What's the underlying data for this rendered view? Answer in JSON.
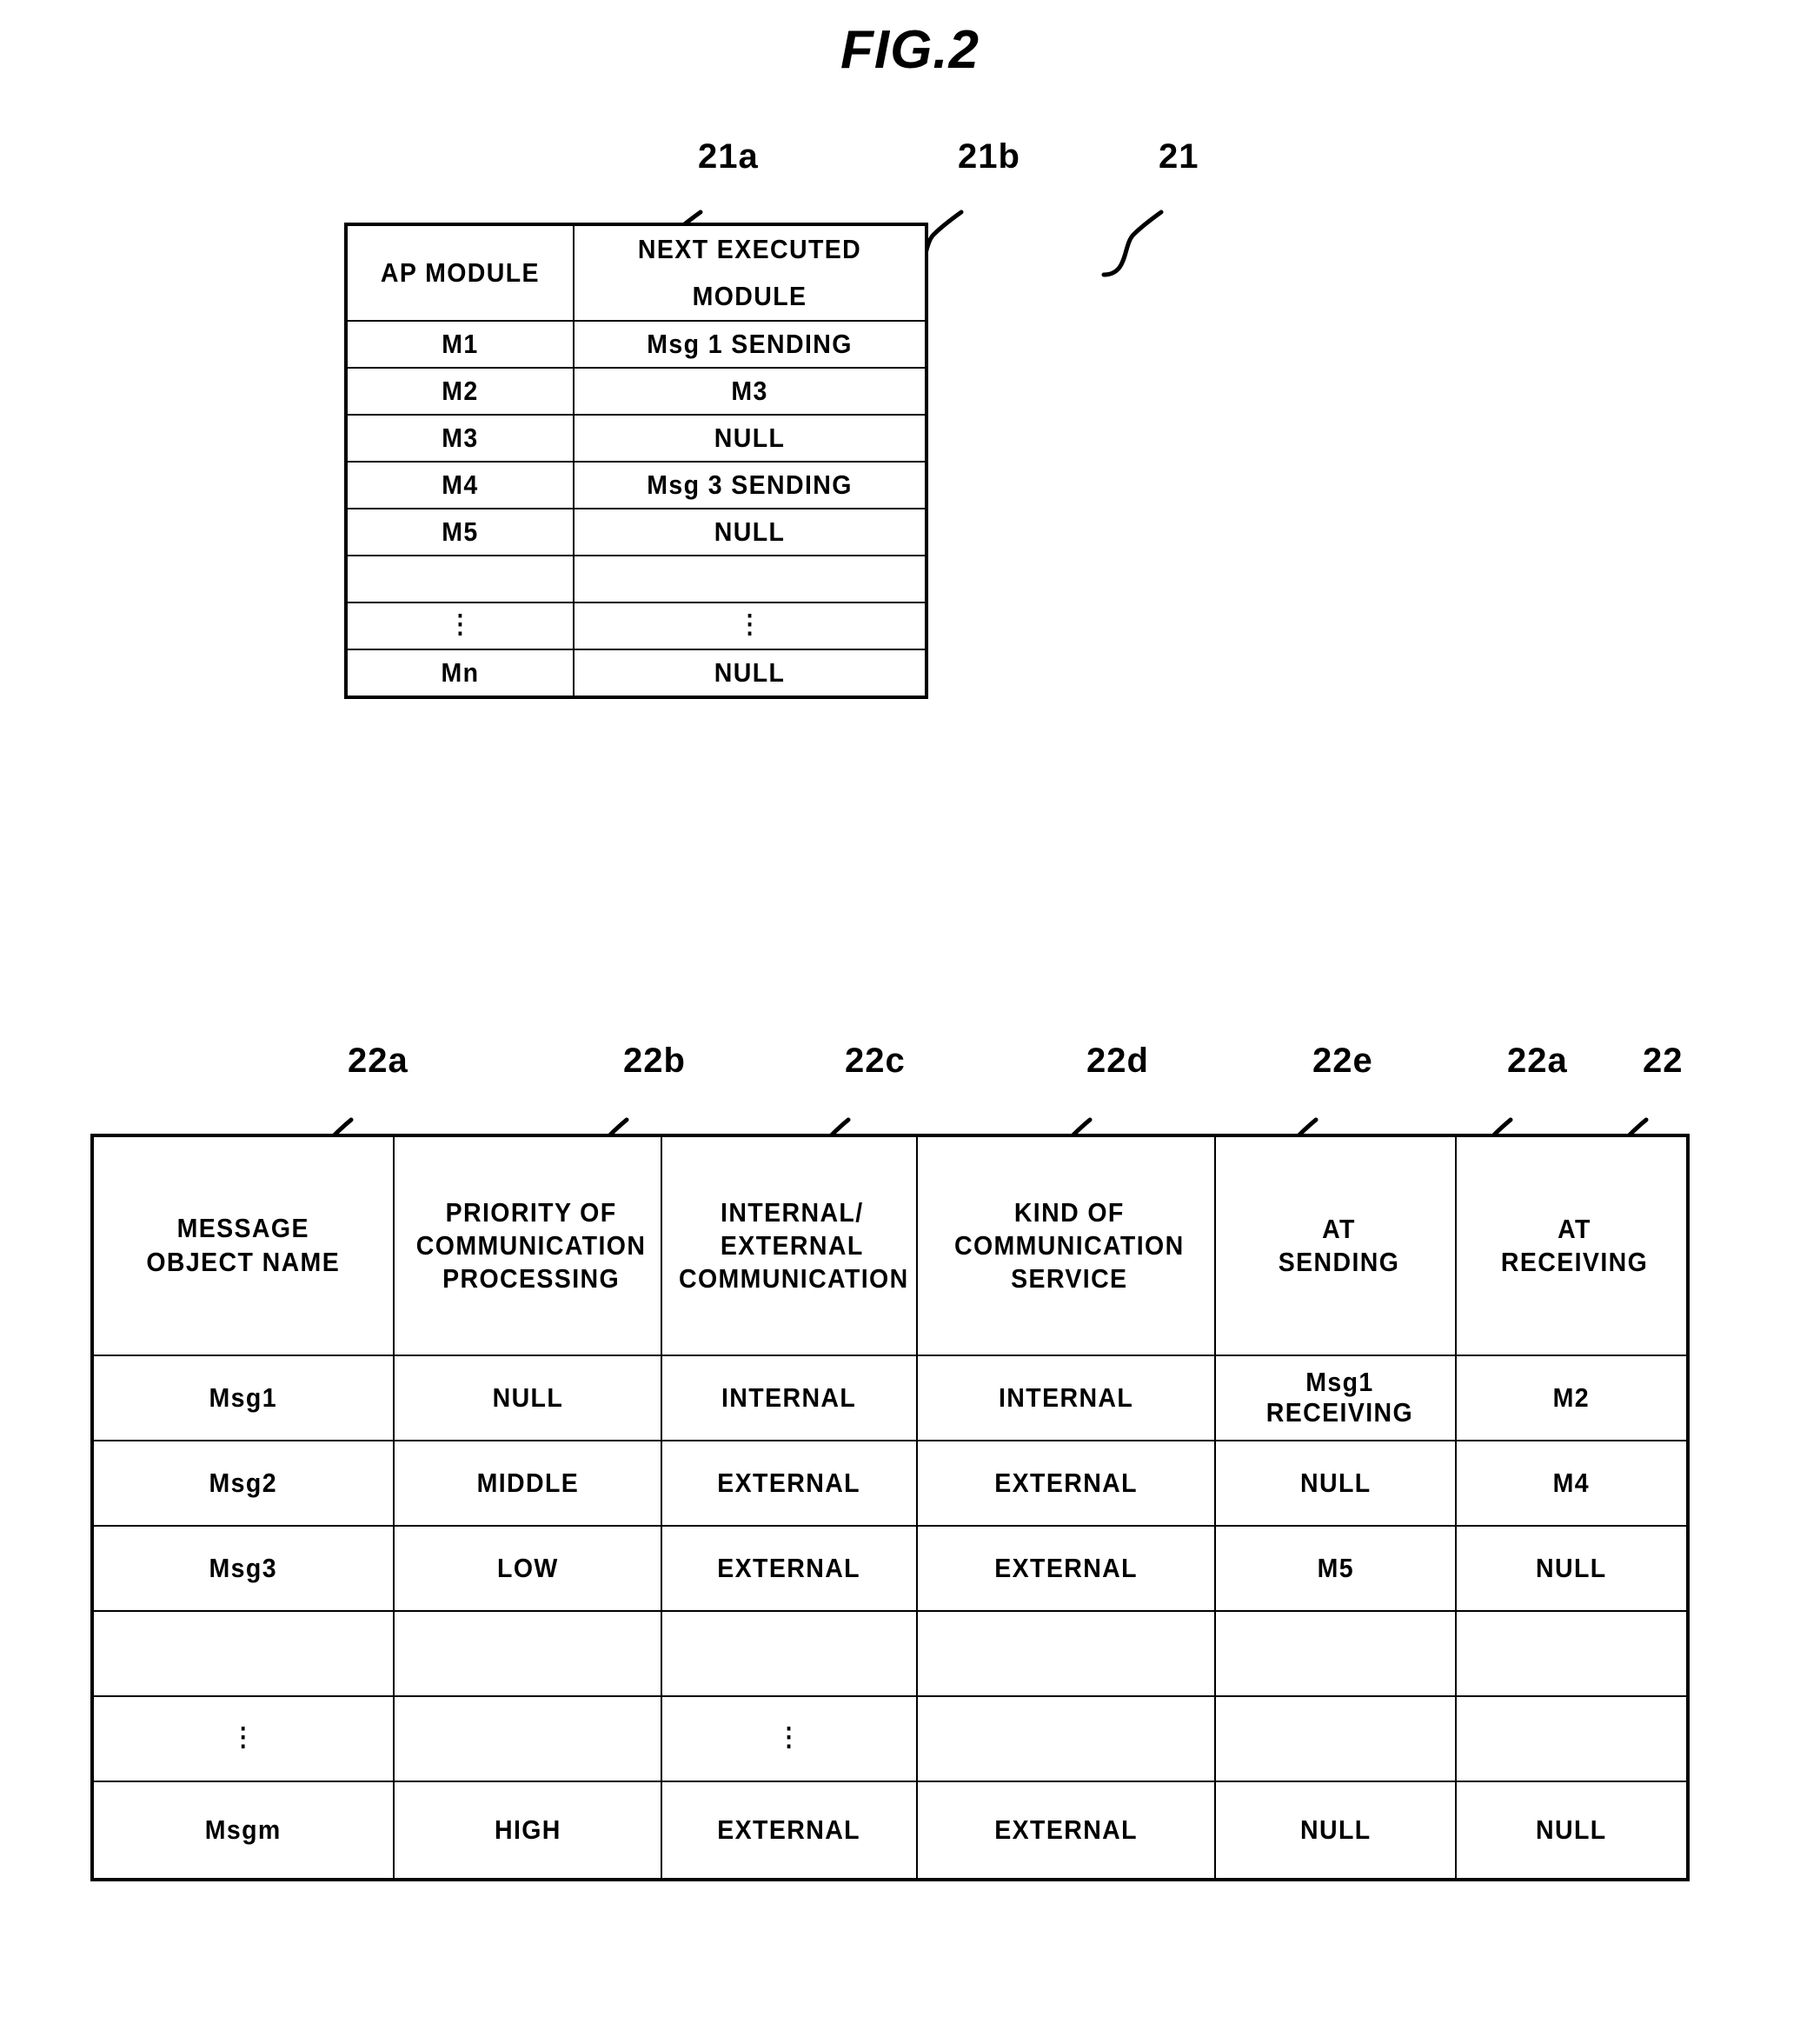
{
  "figure": {
    "title": "FIG.2"
  },
  "table21": {
    "refs": {
      "col_a": "21a",
      "col_b": "21b",
      "table": "21"
    },
    "headers": [
      "AP MODULE",
      "NEXT EXECUTED MODULE"
    ],
    "rows": [
      [
        "M1",
        "Msg 1 SENDING"
      ],
      [
        "M2",
        "M3"
      ],
      [
        "M3",
        "NULL"
      ],
      [
        "M4",
        "Msg 3 SENDING"
      ],
      [
        "M5",
        "NULL"
      ],
      [
        "",
        ""
      ],
      [
        "",
        ""
      ],
      [
        "Mn",
        "NULL"
      ]
    ],
    "ellipsis": "⋮"
  },
  "table22": {
    "refs": {
      "col_a": "22a",
      "col_b": "22b",
      "col_c": "22c",
      "col_d": "22d",
      "col_e": "22e",
      "col_f": "22a",
      "table": "22"
    },
    "headers": [
      "MESSAGE\nOBJECT NAME",
      "PRIORITY OF\nCOMMUNICATION\nPROCESSING",
      "INTERNAL/\nEXTERNAL\nCOMMUNICATION",
      "KIND OF\nCOMMUNICATION\nSERVICE",
      "AT\nSENDING",
      "AT\nRECEIVING"
    ],
    "header_lines": {
      "h1": [
        "MESSAGE",
        "OBJECT NAME"
      ],
      "h2": [
        "PRIORITY OF",
        "COMMUNICATION",
        "PROCESSING"
      ],
      "h3": [
        "INTERNAL/",
        "EXTERNAL",
        "COMMUNICATION"
      ],
      "h4": [
        "KIND OF",
        "COMMUNICATION",
        "SERVICE"
      ],
      "h5": [
        "AT",
        "SENDING"
      ],
      "h6": [
        "AT",
        "RECEIVING"
      ]
    },
    "rows": [
      {
        "name": "Msg1",
        "priority": "NULL",
        "int_ext": "INTERNAL",
        "kind": "INTERNAL",
        "at_sending_l1": "Msg1",
        "at_sending_l2": "RECEIVING",
        "at_receiving": "M2"
      },
      {
        "name": "Msg2",
        "priority": "MIDDLE",
        "int_ext": "EXTERNAL",
        "kind": "EXTERNAL",
        "at_sending_l1": "NULL",
        "at_sending_l2": "",
        "at_receiving": "M4"
      },
      {
        "name": "Msg3",
        "priority": "LOW",
        "int_ext": "EXTERNAL",
        "kind": "EXTERNAL",
        "at_sending_l1": "M5",
        "at_sending_l2": "",
        "at_receiving": "NULL"
      },
      {
        "name": "Msgm",
        "priority": "HIGH",
        "int_ext": "EXTERNAL",
        "kind": "EXTERNAL",
        "at_sending_l1": "NULL",
        "at_sending_l2": "",
        "at_receiving": "NULL"
      }
    ],
    "ellipsis": "⋮"
  }
}
